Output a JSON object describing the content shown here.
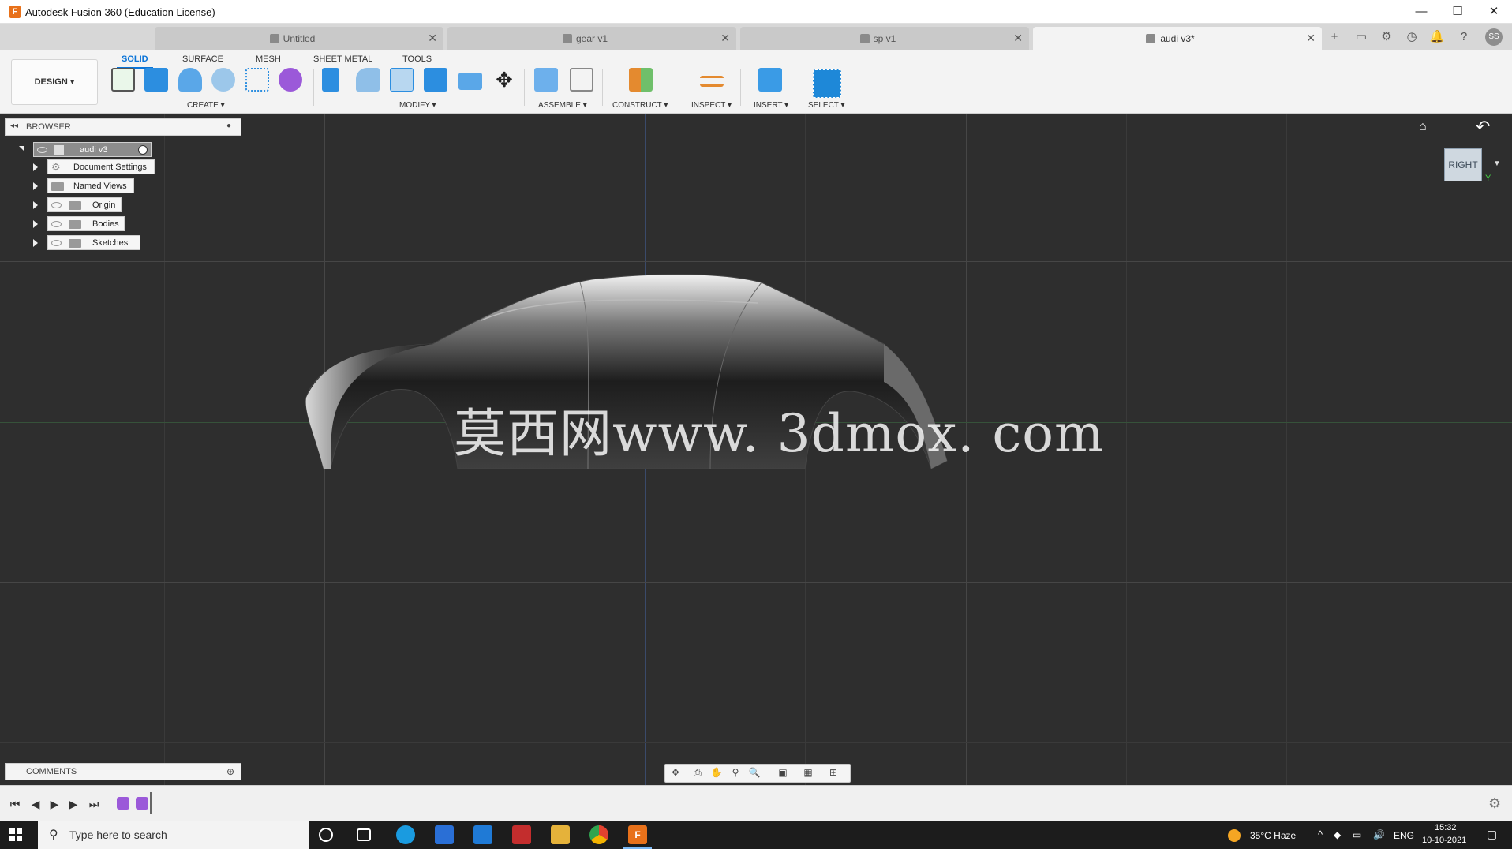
{
  "window": {
    "title": "Autodesk Fusion 360 (Education License)",
    "logo_letter": "F"
  },
  "doc_tabs": [
    {
      "label": "Untitled",
      "active": false
    },
    {
      "label": "gear v1",
      "active": false
    },
    {
      "label": "sp v1",
      "active": false
    },
    {
      "label": "audi v3*",
      "active": true
    }
  ],
  "user_initials": "SS",
  "ribbon": {
    "workspace": "DESIGN",
    "tabs": [
      "SOLID",
      "SURFACE",
      "MESH",
      "SHEET METAL",
      "TOOLS"
    ],
    "groups": [
      "CREATE",
      "MODIFY",
      "ASSEMBLE",
      "CONSTRUCT",
      "INSPECT",
      "INSERT",
      "SELECT"
    ]
  },
  "browser": {
    "title": "BROWSER",
    "root": "audi v3",
    "items": [
      "Document Settings",
      "Named Views",
      "Origin",
      "Bodies",
      "Sketches"
    ]
  },
  "viewcube": {
    "face": "RIGHT",
    "axis_y": "Y"
  },
  "watermark": "莫西网www. 3dmox. com",
  "comments": {
    "title": "COMMENTS"
  },
  "taskbar": {
    "search_placeholder": "Type here to search",
    "weather": "35°C  Haze",
    "language": "ENG",
    "time": "15:32",
    "date": "10-10-2021"
  },
  "colors": {
    "accent": "#0a74d8",
    "canvas": "#2e2e2e",
    "fusion_orange": "#e8711a"
  }
}
